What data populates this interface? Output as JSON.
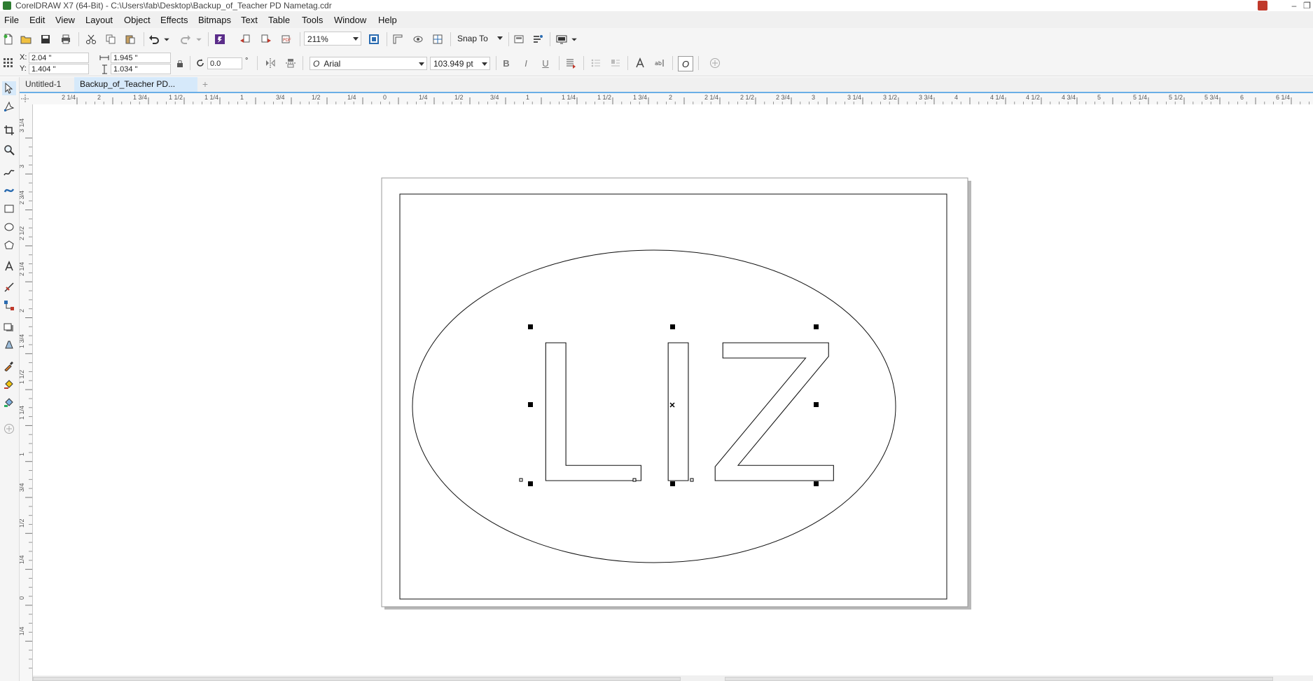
{
  "window": {
    "title": "CorelDRAW X7 (64-Bit) - C:\\Users\\fab\\Desktop\\Backup_of_Teacher PD Nametag.cdr",
    "minimize_glyph": "–",
    "restore_glyph": "❐"
  },
  "menubar": {
    "items": [
      "File",
      "Edit",
      "View",
      "Layout",
      "Object",
      "Effects",
      "Bitmaps",
      "Text",
      "Table",
      "Tools",
      "Window",
      "Help"
    ]
  },
  "toolbar": {
    "zoom_value": "211%",
    "snap_label": "Snap To",
    "icons": [
      "new-document-icon",
      "open-icon",
      "save-icon",
      "print-icon",
      "cut-icon",
      "copy-icon",
      "paste-icon",
      "undo-icon",
      "redo-icon",
      "search-content-icon",
      "import-icon",
      "export-icon",
      "publish-pdf-icon",
      "full-screen-icon",
      "show-rulers-icon",
      "show-grid-icon",
      "show-guidelines-icon",
      "welcome-icon",
      "options-icon",
      "application-launcher-icon"
    ]
  },
  "propbar": {
    "x_label": "X:",
    "x_value": "2.04 \"",
    "y_label": "Y:",
    "y_value": "1.404 \"",
    "width_value": "1.945 \"",
    "height_value": "1.034 \"",
    "rotation_value": "0.0",
    "rotation_unit": "°",
    "font_name": "Arial",
    "font_icon_glyph": "O",
    "font_size": "103.949 pt",
    "bold_glyph": "B",
    "italic_glyph": "I",
    "underline_glyph": "U",
    "interactive_text_glyph": "O"
  },
  "tabs": [
    {
      "label": "Untitled-1",
      "active": false
    },
    {
      "label": "Backup_of_Teacher PD...",
      "active": true
    }
  ],
  "rulers": {
    "horizontal_labels": [
      "2 1/4",
      "2",
      "1 3/4",
      "1 1/2",
      "1 1/4",
      "1",
      "3/4",
      "1/2",
      "1/4",
      "0",
      "1/4",
      "1/2",
      "3/4",
      "1",
      "1 1/4",
      "1 1/2",
      "1 3/4",
      "2",
      "2 1/4",
      "2 1/2",
      "2 3/4",
      "3",
      "3 1/4",
      "3 1/2",
      "3 3/4",
      "4",
      "4 1/4",
      "4 1/2",
      "4 3/4",
      "5",
      "5 1/4",
      "5 1/2",
      "5 3/4",
      "6",
      "6 1/4"
    ],
    "vertical_labels": [
      "3 1/4",
      "3",
      "2 3/4",
      "2 1/2",
      "2 1/4",
      "2",
      "1 3/4",
      "1 1/2",
      "1 1/4",
      "1",
      "3/4",
      "1/2",
      "1/4",
      "0",
      "1/4"
    ],
    "vertical_unit": "inches"
  },
  "document": {
    "text": "LIZ"
  },
  "colors": {
    "menubar_bg": "#f0f0f0",
    "toolbar_bg": "#f5f5f5",
    "active_tab_bg": "#d6e9fa",
    "tab_accent": "#6aaee6",
    "page_shadow": "#b0b0b0"
  }
}
